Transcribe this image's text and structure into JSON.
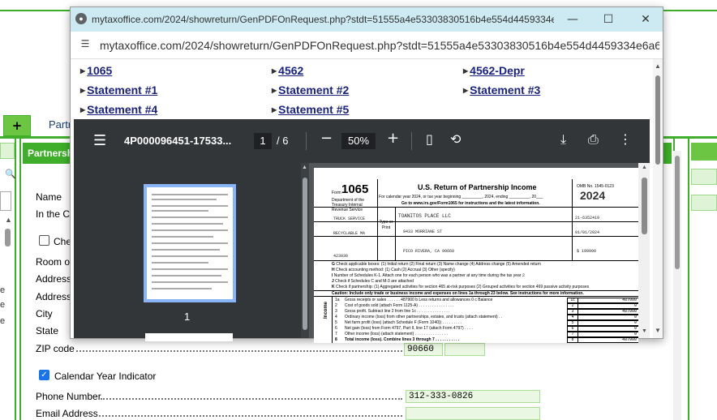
{
  "background": {
    "tab_plus": "+",
    "tab_partner": "Partn",
    "section_title": "Partnersh",
    "fields": {
      "name_label": "Name",
      "in_care_label": "In the Ca",
      "checkbox_label": "Che",
      "room_label": "Room or",
      "address1_label": "Address",
      "address2_label": "Address",
      "city_label": "City",
      "state_label": "State",
      "zip_label": "ZIP code",
      "zip_value": "90660",
      "calendar_label": "Calendar Year Indicator",
      "phone_label": "Phone Number",
      "phone_value": "312-333-0826",
      "email_label": "Email Address"
    },
    "left_edge_letters": [
      "e",
      "e",
      "e"
    ],
    "colors": {
      "green": "#3fae2a",
      "field_bg": "#eaf7e2"
    }
  },
  "popup": {
    "title": "mytaxoffice.com/2024/showreturn/GenPDFOnRequest.php?stdt=51555a4e53303830516b4e554d4459334e6a...",
    "url": "mytaxoffice.com/2024/showreturn/GenPDFOnRequest.php?stdt=51555a4e53303830516b4e554d4459334e6a6...",
    "links": [
      {
        "label": "1065"
      },
      {
        "label": "4562"
      },
      {
        "label": "4562-Depr"
      },
      {
        "label": "Statement #1"
      },
      {
        "label": "Statement #2"
      },
      {
        "label": "Statement #3"
      },
      {
        "label": "Statement #4"
      },
      {
        "label": "Statement #5"
      }
    ],
    "pdf": {
      "filename": "4P000096451-17533...",
      "page_current": "1",
      "page_total": "6",
      "zoom": "50%",
      "thumb_number": "1",
      "form": {
        "form_label": "Form",
        "form_number": "1065",
        "title": "U.S. Return of Partnership Income",
        "subtitle": "For calendar year 2024, or tax year beginning _________, 2024, ending _________, 20___",
        "instructions": "Go to www.irs.gov/Form1065 for instructions and the latest information.",
        "omb": "OMB No. 1545-0123",
        "year": "2024",
        "dept": "Department of the Treasury Internal Revenue Service",
        "principal_activity": "TRUCK SERVICE",
        "principal_product": "RECYCLABLE MA",
        "business_code": "423930",
        "partnership_name": "TOANITOS PLACE LLC",
        "street": "9433 MORRIANE ST",
        "city": "PICO RIVERA, CA 90660",
        "ein": "21-6352419",
        "date_started": "01/01/2024",
        "total_assets": "$ 199990",
        "type_label": "Type or Print",
        "row_g": "Check applicable boxes:  (1) Initial return  (2) Final return  (3) Name change  (4) Address change  (5) Amended return",
        "row_h": "Check accounting method:  (1) Cash  (2) Accrual  (3) Other (specify)",
        "row_i": "Number of Schedules K-1. Attach one for each person who was a partner at any time during the tax year",
        "row_i_val": "2",
        "row_j": "Check if Schedules C and M-3 are attached",
        "row_k": "Check if partnership:  (1) Aggregated activities for section 465 at-risk purposes  (2) Grouped activities for section 469 passive activity purposes",
        "caution": "Caution: Include only trade or business income and expenses on lines 1a through 23 below. See instructions for more information.",
        "income_label": "Income",
        "lines": [
          {
            "num": "1a",
            "text": "Gross receipts or sales . . . . . .    487900     b  Less returns and allowances    0    c  Balance",
            "box": "1c",
            "value": "487900"
          },
          {
            "num": "2",
            "text": "Cost of goods sold (attach Form 1125-A) . . . . . . . . . . . . . . . .",
            "box": "2",
            "value": "0"
          },
          {
            "num": "3",
            "text": "Gross profit. Subtract line 2 from line 1c . . . . . . . . . . . . . . .",
            "box": "3",
            "value": "487900"
          },
          {
            "num": "4",
            "text": "Ordinary income (loss) from other partnerships, estates, and trusts (attach statement) . .",
            "box": "4",
            "value": "0"
          },
          {
            "num": "5",
            "text": "Net farm profit (loss) (attach Schedule F (Form 1040)) . . . . . . . . .",
            "box": "5",
            "value": "0"
          },
          {
            "num": "6",
            "text": "Net gain (loss) from Form 4797, Part II, line 17 (attach Form 4797) . . . .",
            "box": "6",
            "value": "0"
          },
          {
            "num": "7",
            "text": "Other income (loss) (attach statement) . . . . . . . . . . . . . . .",
            "box": "7",
            "value": "0"
          },
          {
            "num": "8",
            "text": "Total income (loss). Combine lines 3 through 7 . . . . . . . . . . .",
            "box": "8",
            "value": "487900"
          }
        ]
      }
    }
  }
}
